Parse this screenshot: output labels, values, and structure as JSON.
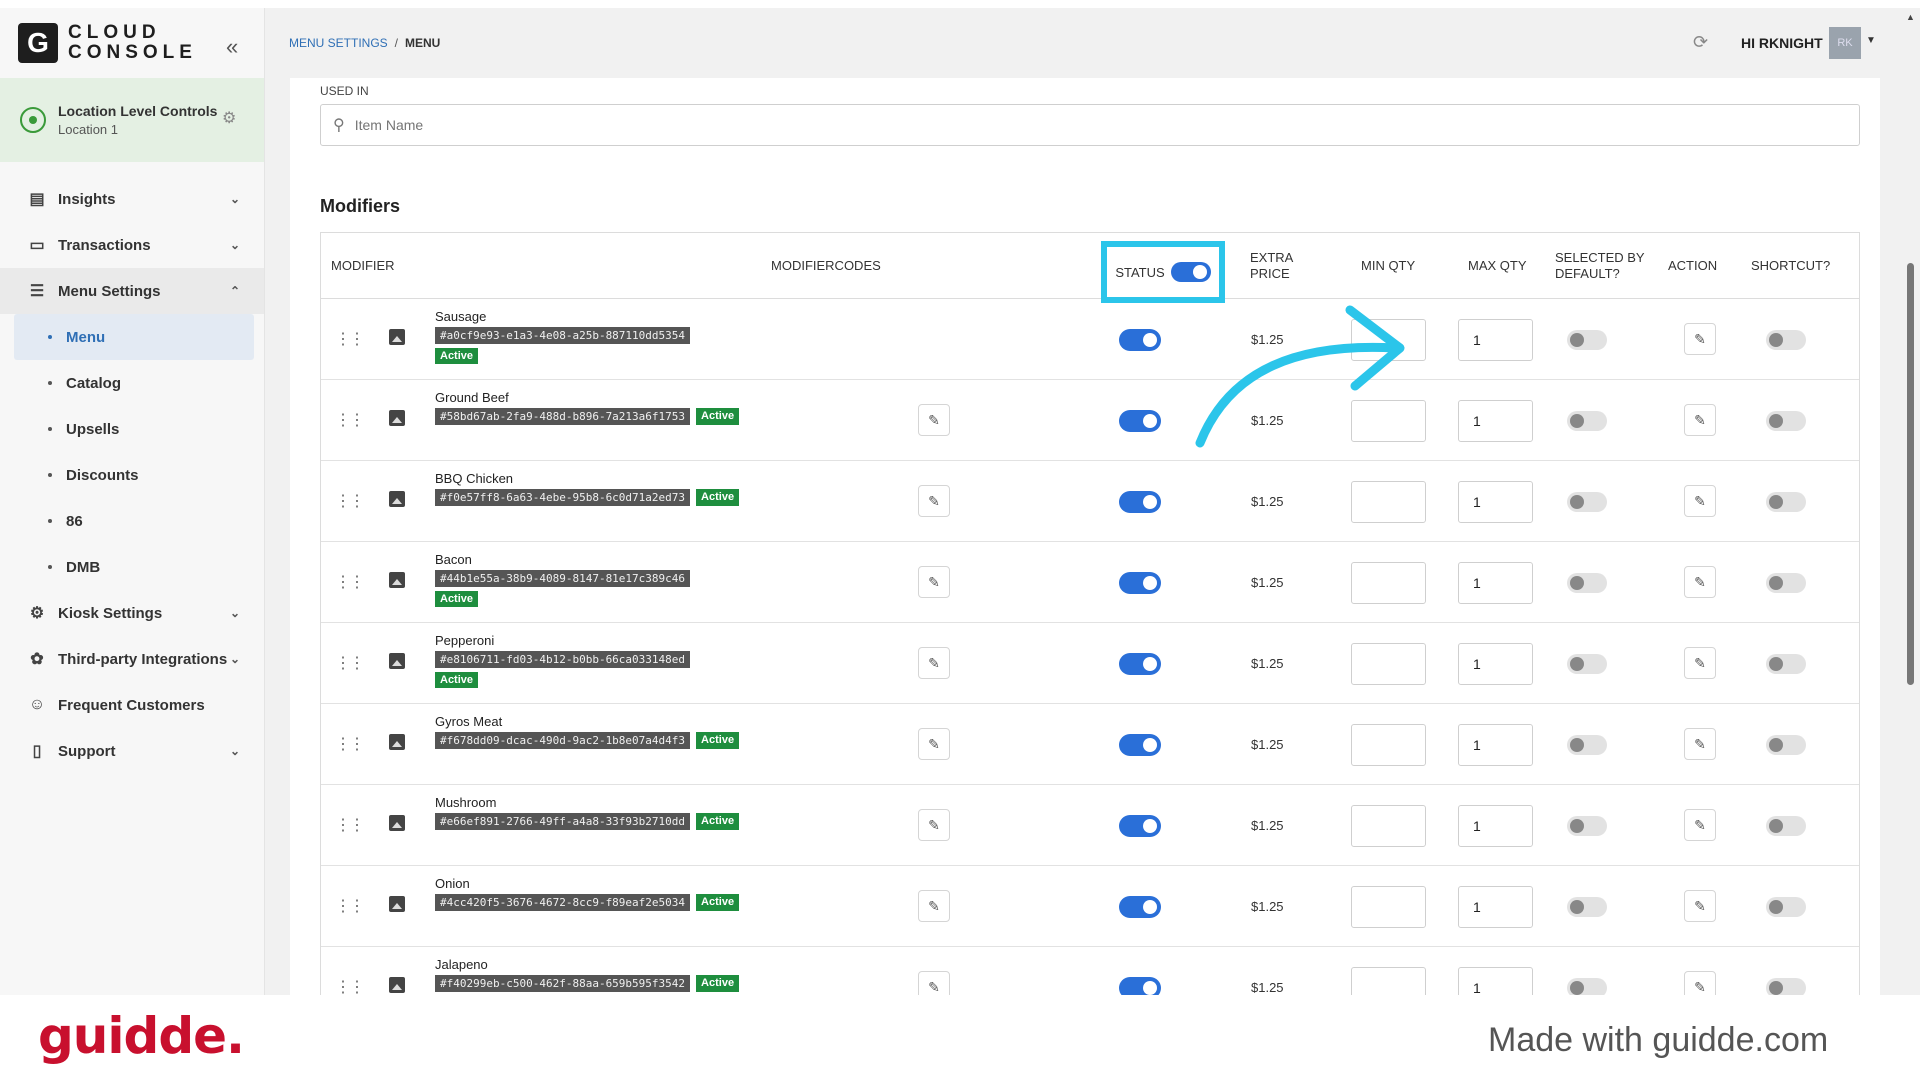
{
  "app": {
    "logo_letter": "G",
    "logo_line1": "CLOUD",
    "logo_line2": "CONSOLE"
  },
  "location": {
    "title": "Location Level Controls",
    "subtitle": "Location 1"
  },
  "sidebar": {
    "items": [
      {
        "label": "Insights",
        "icon": "chart-icon"
      },
      {
        "label": "Transactions",
        "icon": "receipt-icon"
      },
      {
        "label": "Menu Settings",
        "icon": "menu-icon"
      }
    ],
    "menu_sub": [
      "Menu",
      "Catalog",
      "Upsells",
      "Discounts",
      "86",
      "DMB"
    ],
    "items_after": [
      {
        "label": "Kiosk Settings",
        "icon": "gear-icon"
      },
      {
        "label": "Third-party Integrations",
        "icon": "integration-icon"
      },
      {
        "label": "Frequent Customers",
        "icon": "users-icon"
      },
      {
        "label": "Support",
        "icon": "support-icon"
      }
    ]
  },
  "header": {
    "breadcrumb_link": "MENU SETTINGS",
    "breadcrumb_sep": "/",
    "breadcrumb_current": "MENU",
    "greeting": "HI RKNIGHT",
    "avatar_initials": "RK"
  },
  "used_in": {
    "label": "USED IN",
    "placeholder": "Item Name"
  },
  "section_title": "Modifiers",
  "table": {
    "headers": {
      "modifier": "MODIFIER",
      "modifiercodes": "MODIFIERCODES",
      "status": "STATUS",
      "extra_price_1": "EXTRA",
      "extra_price_2": "PRICE",
      "min_qty": "MIN QTY",
      "max_qty": "MAX QTY",
      "selected_1": "SELECTED BY",
      "selected_2": "DEFAULT?",
      "action": "ACTION",
      "shortcut": "SHORTCUT?"
    },
    "rows": [
      {
        "name": "Sausage",
        "code": "#a0cf9e93-e1a3-4e08-a25b-887110dd5354",
        "status_label": "Active",
        "price": "$1.25",
        "min_qty": "",
        "max_qty": "1"
      },
      {
        "name": "Ground Beef",
        "code": "#58bd67ab-2fa9-488d-b896-7a213a6f1753",
        "status_label": "Active",
        "price": "$1.25",
        "min_qty": "",
        "max_qty": "1"
      },
      {
        "name": "BBQ Chicken",
        "code": "#f0e57ff8-6a63-4ebe-95b8-6c0d71a2ed73",
        "status_label": "Active",
        "price": "$1.25",
        "min_qty": "",
        "max_qty": "1"
      },
      {
        "name": "Bacon",
        "code": "#44b1e55a-38b9-4089-8147-81e17c389c46",
        "status_label": "Active",
        "price": "$1.25",
        "min_qty": "",
        "max_qty": "1"
      },
      {
        "name": "Pepperoni",
        "code": "#e8106711-fd03-4b12-b0bb-66ca033148ed",
        "status_label": "Active",
        "price": "$1.25",
        "min_qty": "",
        "max_qty": "1"
      },
      {
        "name": "Gyros Meat",
        "code": "#f678dd09-dcac-490d-9ac2-1b8e07a4d4f3",
        "status_label": "Active",
        "price": "$1.25",
        "min_qty": "",
        "max_qty": "1"
      },
      {
        "name": "Mushroom",
        "code": "#e66ef891-2766-49ff-a4a8-33f93b2710dd",
        "status_label": "Active",
        "price": "$1.25",
        "min_qty": "",
        "max_qty": "1"
      },
      {
        "name": "Onion",
        "code": "#4cc420f5-3676-4672-8cc9-f89eaf2e5034",
        "status_label": "Active",
        "price": "$1.25",
        "min_qty": "",
        "max_qty": "1"
      },
      {
        "name": "Jalapeno",
        "code": "#f40299eb-c500-462f-88aa-659b595f3542",
        "status_label": "Active",
        "price": "$1.25",
        "min_qty": "",
        "max_qty": "1"
      }
    ]
  },
  "footer": {
    "brand": "guidde.",
    "made_with": "Made with guidde.com"
  },
  "colors": {
    "accent": "#2a6fd8",
    "active_badge": "#1e8e3e",
    "highlight": "#2bc5ea",
    "brand_red": "#c8102e"
  }
}
